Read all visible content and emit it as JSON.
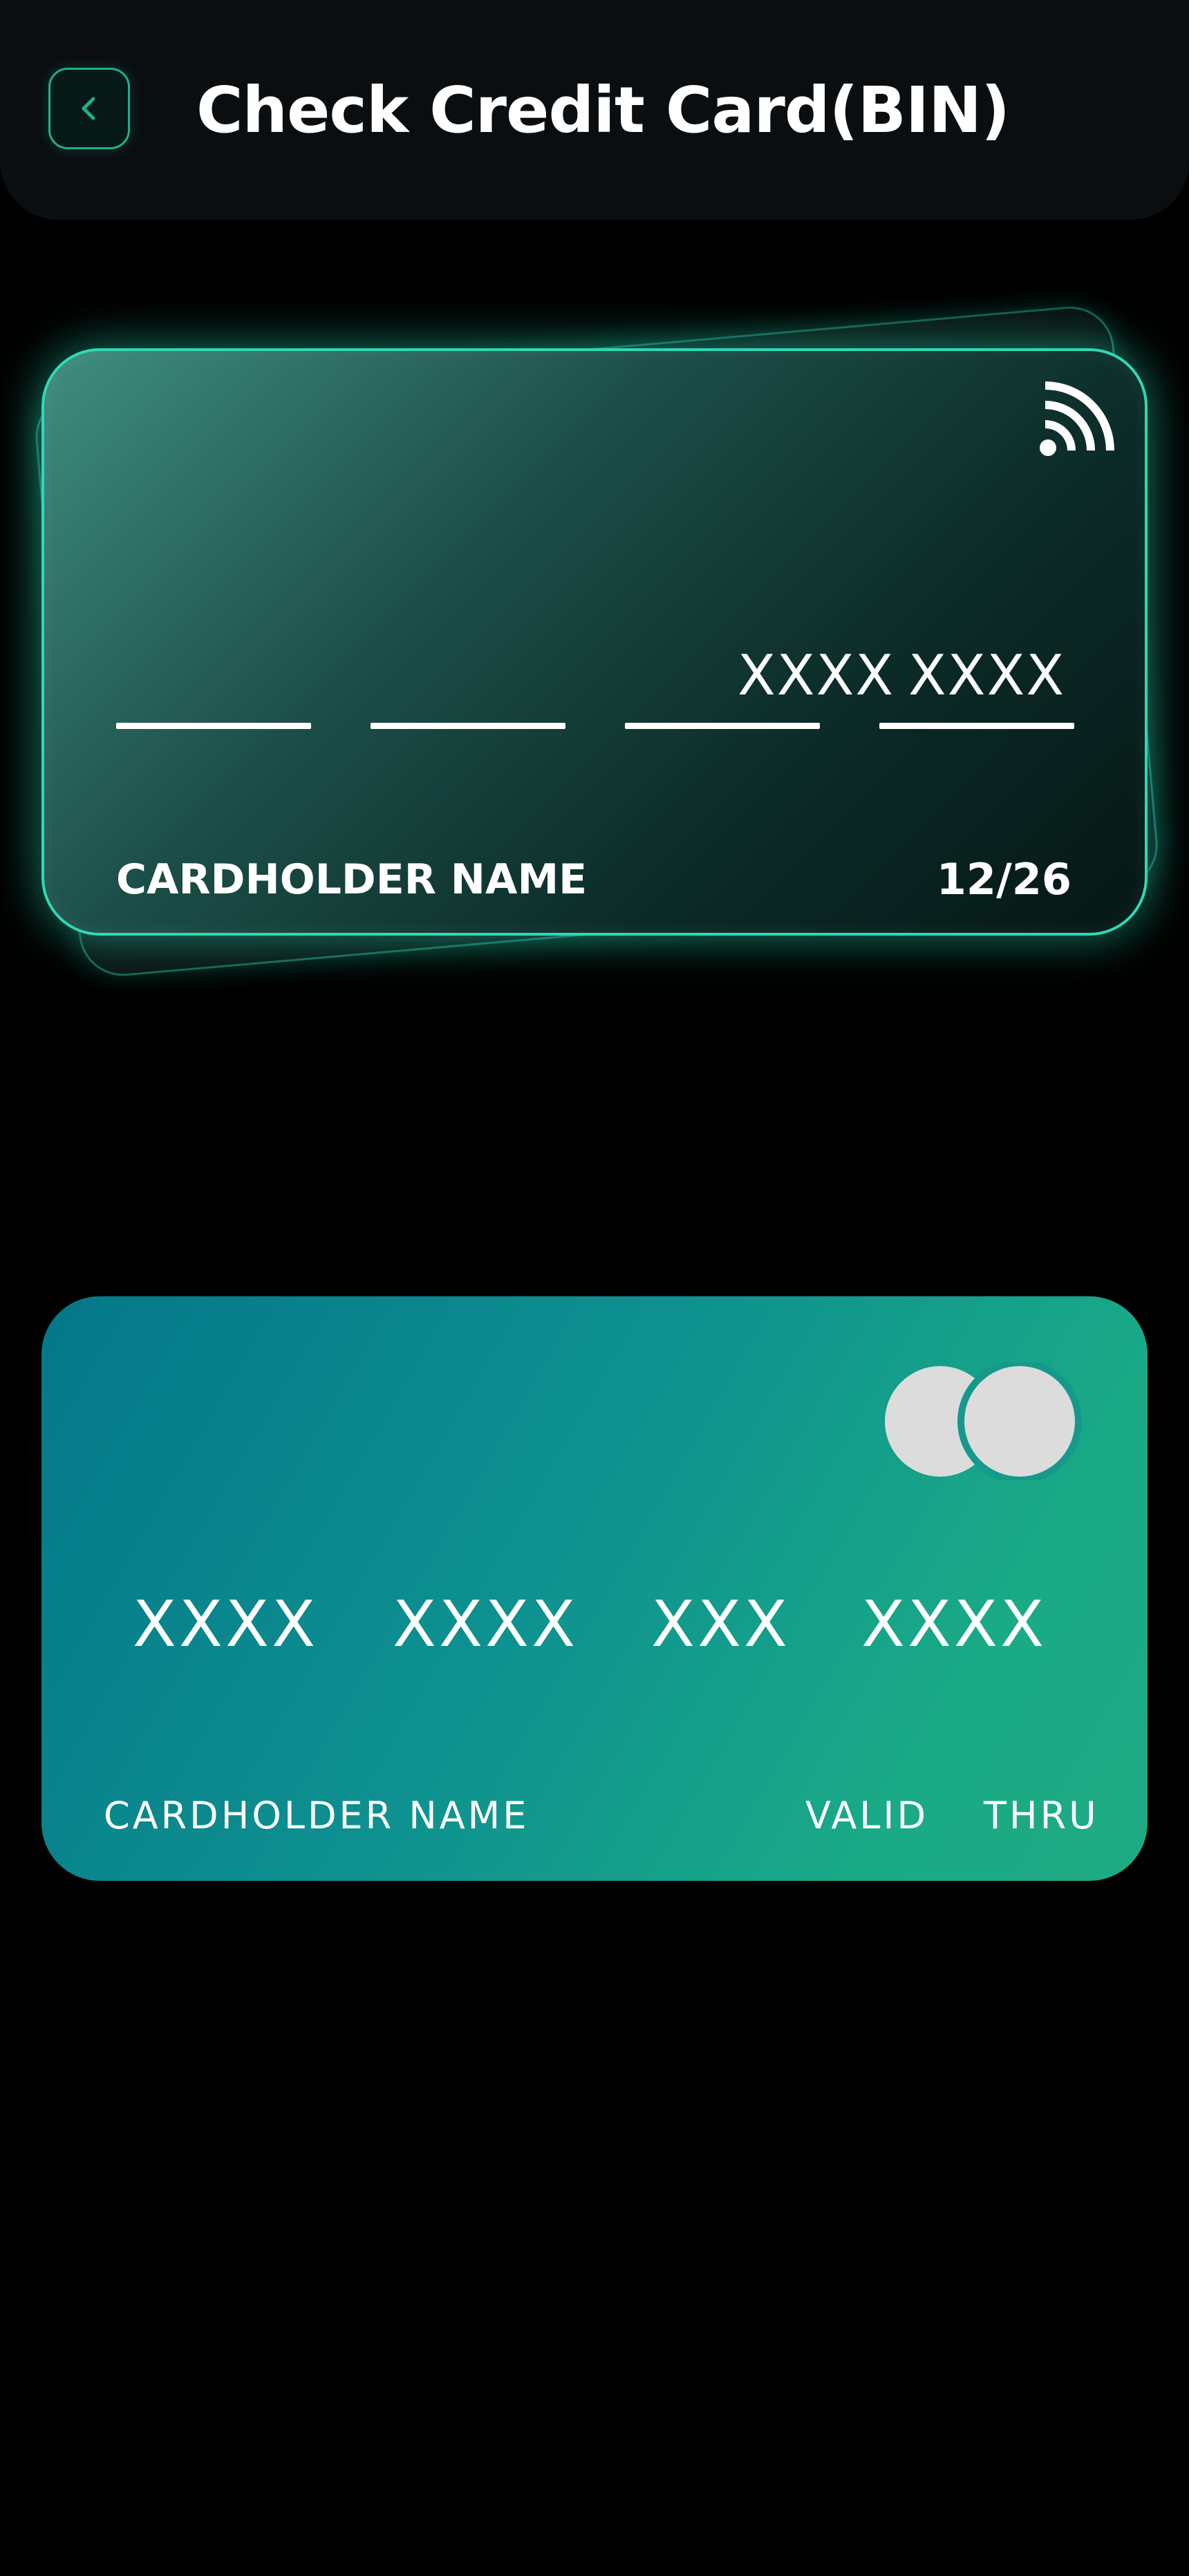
{
  "header": {
    "title": "Check Credit Card(BIN)",
    "back_icon": "chevron-left-icon",
    "accent_color": "#1fae8e"
  },
  "glass_card": {
    "icon": "nfc-contactless-icon",
    "number_groups": [
      "",
      "",
      "XXXX",
      "XXXX"
    ],
    "cardholder_label": "CARDHOLDER NAME",
    "expiry": "12/26",
    "border_color": "#2fd9b4"
  },
  "gradient_card": {
    "logo_icon": "mastercard-logo-icon",
    "number_groups": [
      "XXXX",
      "XXXX",
      "XXX",
      "XXXX"
    ],
    "cardholder_label": "CARDHOLDER NAME",
    "valid_label": "VALID",
    "thru_label": "THRU",
    "gradient_start": "#047789",
    "gradient_end": "#1fab84"
  }
}
